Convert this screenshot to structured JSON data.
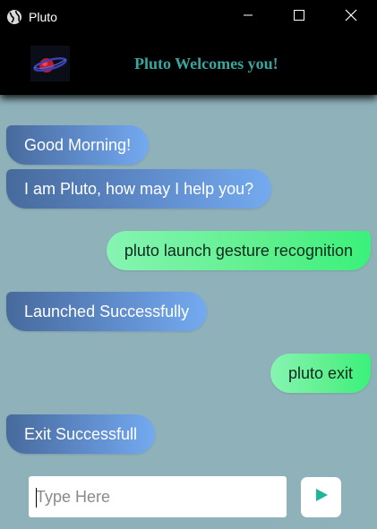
{
  "window": {
    "title": "Pluto",
    "controls": {
      "minimize_icon": "minimize-icon",
      "maximize_icon": "maximize-icon",
      "close_icon": "close-icon"
    }
  },
  "header": {
    "title": "Pluto Welcomes you!",
    "title_color": "#3aa59e",
    "logo_icon": "planet-logo-icon"
  },
  "chat": {
    "background_color": "#8fb1b9",
    "messages": [
      {
        "sender": "bot",
        "text": "Good Morning!"
      },
      {
        "sender": "bot",
        "text": "I am Pluto, how may I help you?"
      },
      {
        "sender": "user",
        "text": "pluto launch gesture recognition"
      },
      {
        "sender": "bot",
        "text": "Launched Successfully"
      },
      {
        "sender": "user",
        "text": "pluto exit"
      },
      {
        "sender": "bot",
        "text": "Exit Successfull"
      }
    ]
  },
  "composer": {
    "placeholder": "Type Here",
    "value": "",
    "send_icon": "send-icon",
    "send_icon_color": "#1fb59a"
  }
}
